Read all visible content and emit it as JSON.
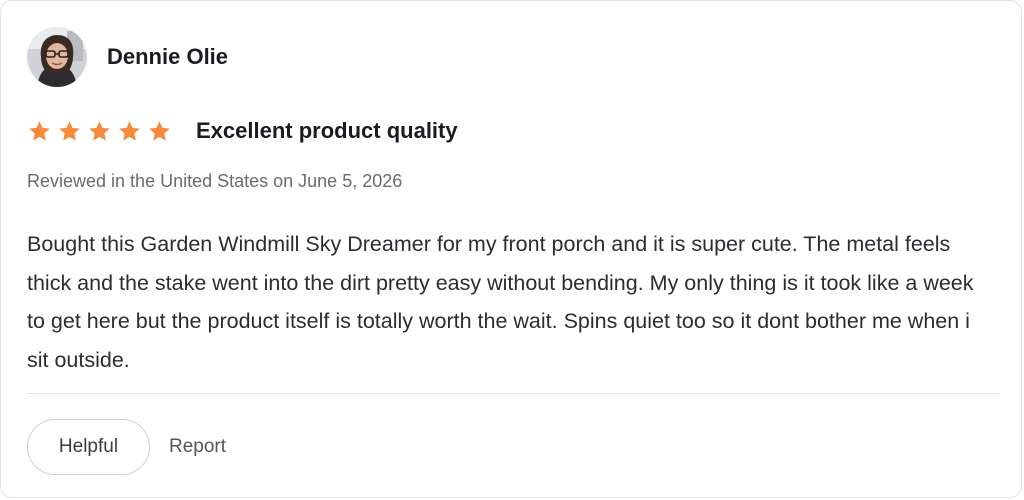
{
  "reviewer": {
    "name": "Dennie Olie"
  },
  "rating": {
    "stars": 5,
    "max": 5,
    "color": "#f58a3a"
  },
  "review": {
    "title": "Excellent product quality",
    "meta": "Reviewed in the United States on June 5, 2026",
    "body": "Bought this Garden Windmill Sky Dreamer for my front porch and it is super cute. The metal feels thick and the stake went into the dirt pretty easy without bending. My only thing is it took like a week to get here but the product itself is totally worth the wait. Spins quiet too so it dont bother me when i sit outside."
  },
  "actions": {
    "helpful_label": "Helpful",
    "report_label": "Report"
  }
}
